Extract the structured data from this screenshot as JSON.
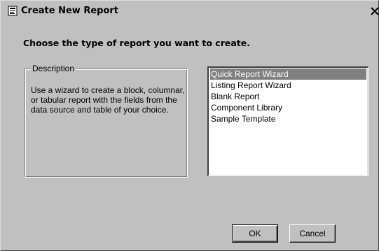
{
  "window": {
    "title": "Create New Report"
  },
  "heading": "Choose the type of report you want to create.",
  "description": {
    "legend": "Description",
    "text": "Use a wizard to create a block, columnar, or tabular report with the fields from the data source and table of your choice."
  },
  "report_types": {
    "selected_index": 0,
    "items": [
      "Quick Report Wizard",
      "Listing Report Wizard",
      "Blank Report",
      "Component Library",
      "Sample Template"
    ]
  },
  "buttons": {
    "ok_label": "OK",
    "cancel_label": "Cancel"
  },
  "icons": {
    "title": "report-app-icon",
    "close": "close-icon"
  },
  "colors": {
    "dialog_face": "#c0c0c0",
    "selection": "#808080",
    "list_background": "#ffffff"
  }
}
